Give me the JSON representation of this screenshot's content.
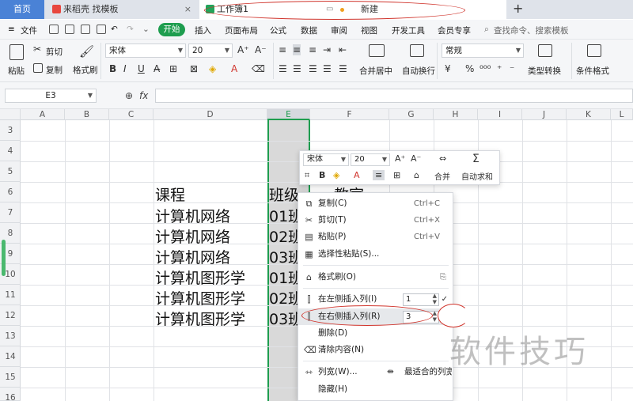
{
  "tabs": {
    "home": "首页",
    "daoke": "来稻壳 找模板",
    "book": "工作簿1",
    "new_tab": "新建",
    "plus": "+"
  },
  "menu": {
    "file": "文件",
    "start": "开始",
    "items": [
      "插入",
      "页面布局",
      "公式",
      "数据",
      "审阅",
      "视图",
      "开发工具",
      "会员专享"
    ],
    "search": "查找命令、搜索模板"
  },
  "ribbon": {
    "paste": "粘贴",
    "cut": "剪切",
    "copy": "复制",
    "format_painter": "格式刷",
    "font_name": "宋体",
    "font_size": "20",
    "merge_center": "合并居中",
    "wrap": "自动换行",
    "number_format": "常规",
    "type_convert": "类型转换",
    "cond_format": "条件格式"
  },
  "formula_bar": {
    "cell_ref": "E3",
    "fx": "fx",
    "value": ""
  },
  "columns": [
    "A",
    "B",
    "C",
    "D",
    "E",
    "F",
    "G",
    "H",
    "I",
    "J",
    "K",
    "L"
  ],
  "rows": [
    "3",
    "4",
    "5",
    "6",
    "7",
    "8",
    "9",
    "10",
    "11",
    "12",
    "13",
    "14",
    "15",
    "16"
  ],
  "cells": {
    "d_header": "课程",
    "e_header": "班级",
    "f_header": "教室",
    "d": [
      "计算机网络",
      "计算机网络",
      "计算机网络",
      "计算机图形学",
      "计算机图形学",
      "计算机图形学"
    ],
    "e": [
      "01班",
      "02班",
      "03班",
      "01班",
      "02班",
      "03班"
    ]
  },
  "mini_toolbar": {
    "font": "宋体",
    "size": "20",
    "merge": "合并",
    "autosum": "自动求和"
  },
  "context_menu": {
    "copy": "复制(C)",
    "copy_sc": "Ctrl+C",
    "cut": "剪切(T)",
    "cut_sc": "Ctrl+X",
    "paste": "粘贴(P)",
    "paste_sc": "Ctrl+V",
    "paste_special": "选择性粘贴(S)...",
    "format_painter": "格式刷(O)",
    "insert_left": "在左侧插入列(I)",
    "insert_left_count": "1",
    "insert_right": "在右侧插入列(R)",
    "insert_right_count": "3",
    "delete": "删除(D)",
    "clear": "清除内容(N)",
    "col_width": "列宽(W)...",
    "best_fit": "最适合的列宽",
    "hide": "隐藏(H)"
  },
  "watermark": "软件技巧"
}
